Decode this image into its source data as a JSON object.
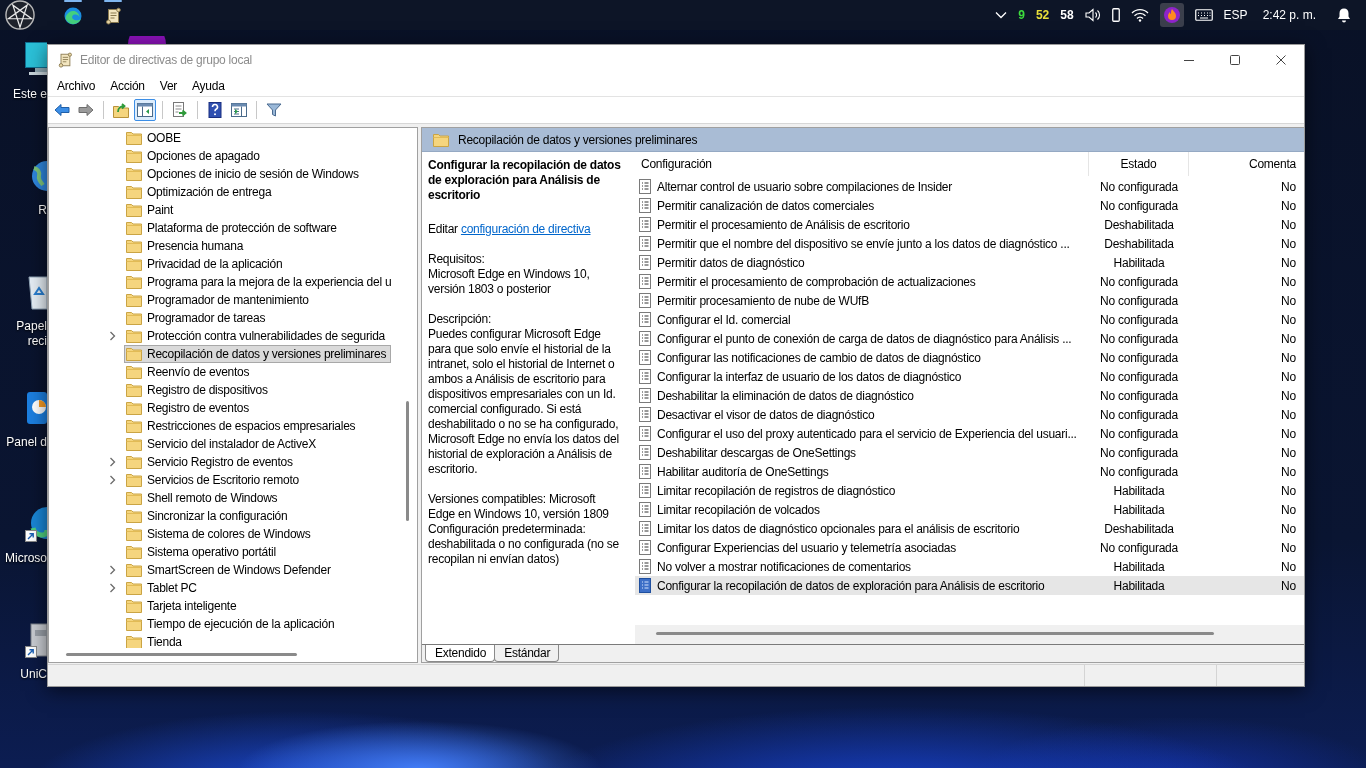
{
  "taskbar": {
    "apps": [
      {
        "kind": "browser",
        "running": true
      },
      {
        "kind": "policy-editor",
        "running": true
      }
    ],
    "tray_readings": [
      {
        "text": "9",
        "color": "#3ddc3d"
      },
      {
        "text": "52",
        "color": "#e8e03a"
      },
      {
        "text": "58",
        "color": "#ffffff"
      }
    ],
    "language": "ESP",
    "clock": "2:42 p. m."
  },
  "desktop_icons": [
    {
      "kind": "computer",
      "label": "Este e",
      "shortcut": false
    },
    {
      "kind": "globe",
      "label": "R",
      "shortcut": false
    },
    {
      "kind": "recycle-bin",
      "label": "Papel reci",
      "shortcut": false
    },
    {
      "kind": "control-panel",
      "label": "Panel d",
      "shortcut": false
    },
    {
      "kind": "browser",
      "label": "Microso",
      "shortcut": true
    },
    {
      "kind": "app",
      "label": "UniC",
      "shortcut": true
    }
  ],
  "window": {
    "title": "Editor de directivas de grupo local",
    "menu": [
      "Archivo",
      "Acción",
      "Ver",
      "Ayuda"
    ],
    "toolbar": [
      [
        {
          "kind": "back",
          "disabled": false,
          "pressed": false
        },
        {
          "kind": "forward",
          "disabled": true,
          "pressed": false
        }
      ],
      [
        {
          "kind": "up",
          "disabled": false,
          "pressed": false
        },
        {
          "kind": "tree",
          "disabled": false,
          "pressed": true
        }
      ],
      [
        {
          "kind": "export",
          "disabled": false,
          "pressed": false
        }
      ],
      [
        {
          "kind": "help",
          "disabled": false,
          "pressed": false
        },
        {
          "kind": "properties",
          "disabled": false,
          "pressed": false
        }
      ],
      [
        {
          "kind": "filter",
          "disabled": false,
          "pressed": false
        }
      ]
    ],
    "tree": [
      {
        "label": "OOBE",
        "expandable": false,
        "selected": false
      },
      {
        "label": "Opciones de apagado",
        "expandable": false,
        "selected": false
      },
      {
        "label": "Opciones de inicio de sesión de Windows",
        "expandable": false,
        "selected": false
      },
      {
        "label": "Optimización de entrega",
        "expandable": false,
        "selected": false
      },
      {
        "label": "Paint",
        "expandable": false,
        "selected": false
      },
      {
        "label": "Plataforma de protección de software",
        "expandable": false,
        "selected": false
      },
      {
        "label": "Presencia humana",
        "expandable": false,
        "selected": false
      },
      {
        "label": "Privacidad de la aplicación",
        "expandable": false,
        "selected": false
      },
      {
        "label": "Programa para la mejora de la experiencia del u",
        "expandable": false,
        "selected": false
      },
      {
        "label": "Programador de mantenimiento",
        "expandable": false,
        "selected": false
      },
      {
        "label": "Programador de tareas",
        "expandable": false,
        "selected": false
      },
      {
        "label": "Protección contra vulnerabilidades de segurida",
        "expandable": true,
        "selected": false
      },
      {
        "label": "Recopilación de datos y versiones preliminares",
        "expandable": false,
        "selected": true
      },
      {
        "label": "Reenvío de eventos",
        "expandable": false,
        "selected": false
      },
      {
        "label": "Registro de dispositivos",
        "expandable": false,
        "selected": false
      },
      {
        "label": "Registro de eventos",
        "expandable": false,
        "selected": false
      },
      {
        "label": "Restricciones de espacios empresariales",
        "expandable": false,
        "selected": false
      },
      {
        "label": "Servicio del instalador de ActiveX",
        "expandable": false,
        "selected": false
      },
      {
        "label": "Servicio Registro de eventos",
        "expandable": true,
        "selected": false
      },
      {
        "label": "Servicios de Escritorio remoto",
        "expandable": true,
        "selected": false
      },
      {
        "label": "Shell remoto de Windows",
        "expandable": false,
        "selected": false
      },
      {
        "label": "Sincronizar la configuración",
        "expandable": false,
        "selected": false
      },
      {
        "label": "Sistema de colores de Windows",
        "expandable": false,
        "selected": false
      },
      {
        "label": "Sistema operativo portátil",
        "expandable": false,
        "selected": false
      },
      {
        "label": "SmartScreen de Windows Defender",
        "expandable": true,
        "selected": false
      },
      {
        "label": "Tablet PC",
        "expandable": true,
        "selected": false
      },
      {
        "label": "Tarjeta inteligente",
        "expandable": false,
        "selected": false
      },
      {
        "label": "Tiempo de ejecución de la aplicación",
        "expandable": false,
        "selected": false
      },
      {
        "label": "Tienda",
        "expandable": false,
        "selected": false
      }
    ],
    "details": {
      "header": "Recopilación de datos y versiones preliminares",
      "policy": {
        "title": "Configurar la recopilación de datos de exploración para Análisis de escritorio",
        "edit_prefix": "Editar",
        "edit_link": "configuración de directiva",
        "requirements_label": "Requisitos:",
        "requirements": "Microsoft Edge en Windows 10, versión 1803 o posterior",
        "description_label": "Descripción:",
        "description": "Puedes configurar Microsoft Edge para que solo envíe el historial de la intranet, solo el historial de Internet o ambos a Análisis de escritorio para dispositivos empresariales con un Id. comercial configurado. Si está deshabilitado o no se ha configurado, Microsoft Edge no envía los datos del historial de exploración a Análisis de escritorio.",
        "compatible": "Versiones compatibles: Microsoft Edge en Windows 10, versión 1809",
        "default": "Configuración predeterminada: deshabilitada o no configurada (no se recopilan ni envían datos)"
      },
      "columns": [
        "Configuración",
        "Estado",
        "Comenta"
      ],
      "rows": [
        {
          "setting": "Alternar control de usuario sobre compilaciones de Insider",
          "state": "No configurada",
          "comment": "No",
          "selected": false
        },
        {
          "setting": "Permitir canalización de datos comerciales",
          "state": "No configurada",
          "comment": "No",
          "selected": false
        },
        {
          "setting": "Permitir el procesamiento de Análisis de escritorio",
          "state": "Deshabilitada",
          "comment": "No",
          "selected": false
        },
        {
          "setting": "Permitir que el nombre del dispositivo se envíe junto a los datos de diagnóstico ...",
          "state": "Deshabilitada",
          "comment": "No",
          "selected": false
        },
        {
          "setting": "Permitir datos de diagnóstico",
          "state": "Habilitada",
          "comment": "No",
          "selected": false
        },
        {
          "setting": "Permitir el procesamiento de comprobación de actualizaciones",
          "state": "No configurada",
          "comment": "No",
          "selected": false
        },
        {
          "setting": "Permitir procesamiento de nube de WUfB",
          "state": "No configurada",
          "comment": "No",
          "selected": false
        },
        {
          "setting": "Configurar el Id. comercial",
          "state": "No configurada",
          "comment": "No",
          "selected": false
        },
        {
          "setting": "Configurar el punto de conexión de carga de datos de diagnóstico para Análisis ...",
          "state": "No configurada",
          "comment": "No",
          "selected": false
        },
        {
          "setting": "Configurar las notificaciones de cambio de datos de diagnóstico",
          "state": "No configurada",
          "comment": "No",
          "selected": false
        },
        {
          "setting": "Configurar la interfaz de usuario de los datos de diagnóstico",
          "state": "No configurada",
          "comment": "No",
          "selected": false
        },
        {
          "setting": "Deshabilitar la eliminación de datos de diagnóstico",
          "state": "No configurada",
          "comment": "No",
          "selected": false
        },
        {
          "setting": "Desactivar el visor de datos de diagnóstico",
          "state": "No configurada",
          "comment": "No",
          "selected": false
        },
        {
          "setting": "Configurar el uso del proxy autenticado para el servicio de Experiencia del usuari...",
          "state": "No configurada",
          "comment": "No",
          "selected": false
        },
        {
          "setting": "Deshabilitar descargas de OneSettings",
          "state": "No configurada",
          "comment": "No",
          "selected": false
        },
        {
          "setting": "Habilitar auditoría de OneSettings",
          "state": "No configurada",
          "comment": "No",
          "selected": false
        },
        {
          "setting": "Limitar recopilación de registros de diagnóstico",
          "state": "Habilitada",
          "comment": "No",
          "selected": false
        },
        {
          "setting": "Limitar recopilación de volcados",
          "state": "Habilitada",
          "comment": "No",
          "selected": false
        },
        {
          "setting": "Limitar los datos de diagnóstico opcionales para el análisis de escritorio",
          "state": "Deshabilitada",
          "comment": "No",
          "selected": false
        },
        {
          "setting": "Configurar Experiencias del usuario y telemetría asociadas",
          "state": "No configurada",
          "comment": "No",
          "selected": false
        },
        {
          "setting": "No volver a mostrar notificaciones de comentarios",
          "state": "Habilitada",
          "comment": "No",
          "selected": false
        },
        {
          "setting": "Configurar la recopilación de datos de exploración para Análisis de escritorio",
          "state": "Habilitada",
          "comment": "No",
          "selected": true
        }
      ],
      "tabs": [
        {
          "label": "Extendido",
          "selected": true
        },
        {
          "label": "Estándar",
          "selected": false
        }
      ]
    }
  }
}
